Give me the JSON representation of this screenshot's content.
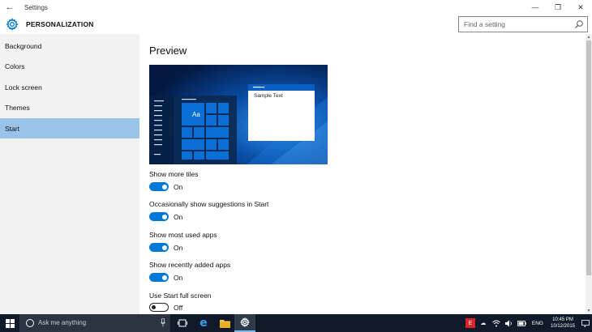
{
  "window": {
    "title": "Settings",
    "back_glyph": "←",
    "minimize_glyph": "—",
    "restore_glyph": "❐",
    "close_glyph": "✕"
  },
  "header": {
    "page_title": "PERSONALIZATION",
    "search_placeholder": "Find a setting"
  },
  "sidebar": {
    "items": [
      {
        "label": "Background",
        "active": false
      },
      {
        "label": "Colors",
        "active": false
      },
      {
        "label": "Lock screen",
        "active": false
      },
      {
        "label": "Themes",
        "active": false
      },
      {
        "label": "Start",
        "active": true
      }
    ]
  },
  "main": {
    "section_title": "Preview",
    "preview": {
      "tile_label": "Aa",
      "window_text": "Sample Text"
    },
    "settings": [
      {
        "label": "Show more tiles",
        "state": "On",
        "on": true
      },
      {
        "label": "Occasionally show suggestions in Start",
        "state": "On",
        "on": true
      },
      {
        "label": "Show most used apps",
        "state": "On",
        "on": true
      },
      {
        "label": "Show recently added apps",
        "state": "On",
        "on": true
      },
      {
        "label": "Use Start full screen",
        "state": "Off",
        "on": false
      }
    ]
  },
  "taskbar": {
    "search_text": "Ask me anything",
    "language": "ENG",
    "time": "10:45 PM",
    "date": "10/12/2015"
  },
  "colors": {
    "accent": "#0078d7",
    "selection": "#99c3e9",
    "sidebar_bg": "#f2f2f2",
    "taskbar_bg": "#101a2a"
  }
}
